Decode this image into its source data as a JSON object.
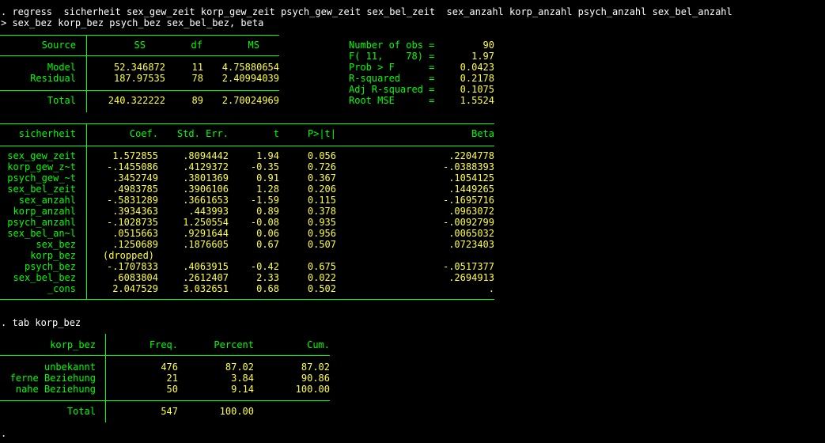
{
  "commands": {
    "regress_line1": ". regress  sicherheit sex_gew_zeit korp_gew_zeit psych_gew_zeit sex_bel_zeit  sex_anzahl korp_anzahl psych_anzahl sex_bel_anzahl",
    "regress_line2": "> sex_bez korp_bez psych_bez sex_bel_bez, beta",
    "tab": ". tab korp_bez",
    "prompt": "."
  },
  "anova": {
    "headers": [
      "Source",
      "SS",
      "df",
      "MS"
    ],
    "rows": [
      {
        "source": "Model",
        "ss": "52.346872",
        "df": "11",
        "ms": "4.75880654"
      },
      {
        "source": "Residual",
        "ss": "187.97535",
        "df": "78",
        "ms": "2.40994039"
      }
    ],
    "total": {
      "source": "Total",
      "ss": "240.322222",
      "df": "89",
      "ms": "2.70024969"
    }
  },
  "fit_stats": [
    {
      "label": "Number of obs =",
      "value": "90"
    },
    {
      "label": "F( 11,    78) =",
      "value": "1.97"
    },
    {
      "label": "Prob > F      =",
      "value": "0.0423"
    },
    {
      "label": "R-squared     =",
      "value": "0.2178"
    },
    {
      "label": "Adj R-squared =",
      "value": "0.1075"
    },
    {
      "label": "Root MSE      =",
      "value": "1.5524"
    }
  ],
  "coef_table": {
    "depvar": "sicherheit",
    "headers": [
      "Coef.",
      "Std. Err.",
      "t",
      "P>|t|",
      "Beta"
    ],
    "rows": [
      {
        "var": "sex_gew_zeit",
        "coef": "1.572855",
        "se": ".8094442",
        "t": "1.94",
        "p": "0.056",
        "beta": ".2204778"
      },
      {
        "var": "korp_gew_z~t",
        "coef": "-.1455086",
        "se": ".4129372",
        "t": "-0.35",
        "p": "0.726",
        "beta": "-.0388393"
      },
      {
        "var": "psych_gew_~t",
        "coef": ".3452749",
        "se": ".3801369",
        "t": "0.91",
        "p": "0.367",
        "beta": ".1054125"
      },
      {
        "var": "sex_bel_zeit",
        "coef": ".4983785",
        "se": ".3906106",
        "t": "1.28",
        "p": "0.206",
        "beta": ".1449265"
      },
      {
        "var": "sex_anzahl",
        "coef": "-.5831289",
        "se": ".3661653",
        "t": "-1.59",
        "p": "0.115",
        "beta": "-.1695716"
      },
      {
        "var": "korp_anzahl",
        "coef": ".3934363",
        "se": ".443993",
        "t": "0.89",
        "p": "0.378",
        "beta": ".0963072"
      },
      {
        "var": "psych_anzahl",
        "coef": "-.1028735",
        "se": "1.250554",
        "t": "-0.08",
        "p": "0.935",
        "beta": "-.0092799"
      },
      {
        "var": "sex_bel_an~l",
        "coef": ".0515663",
        "se": ".9291644",
        "t": "0.06",
        "p": "0.956",
        "beta": ".0065032"
      },
      {
        "var": "sex_bez",
        "coef": ".1250689",
        "se": ".1876605",
        "t": "0.67",
        "p": "0.507",
        "beta": ".0723403"
      },
      {
        "var": "korp_bez",
        "coef": "(dropped)",
        "se": "",
        "t": "",
        "p": "",
        "beta": ""
      },
      {
        "var": "psych_bez",
        "coef": "-.1707833",
        "se": ".4063915",
        "t": "-0.42",
        "p": "0.675",
        "beta": "-.0517377"
      },
      {
        "var": "sex_bel_bez",
        "coef": ".6083804",
        "se": ".2612407",
        "t": "2.33",
        "p": "0.022",
        "beta": ".2694913"
      },
      {
        "var": "_cons",
        "coef": "2.047529",
        "se": "3.032651",
        "t": "0.68",
        "p": "0.502",
        "beta": "."
      }
    ]
  },
  "tab_table": {
    "var": "korp_bez",
    "headers": [
      "Freq.",
      "Percent",
      "Cum."
    ],
    "rows": [
      {
        "label": "unbekannt",
        "freq": "476",
        "pct": "87.02",
        "cum": "87.02"
      },
      {
        "label": "ferne Beziehung",
        "freq": "21",
        "pct": "3.84",
        "cum": "90.86"
      },
      {
        "label": "nahe Beziehung",
        "freq": "50",
        "pct": "9.14",
        "cum": "100.00"
      }
    ],
    "total": {
      "label": "Total",
      "freq": "547",
      "pct": "100.00"
    }
  },
  "colors": {
    "background": "#000000",
    "command_text": "#ffffff",
    "labels_and_rules": "#00ff00",
    "values": "#ffff3c"
  }
}
